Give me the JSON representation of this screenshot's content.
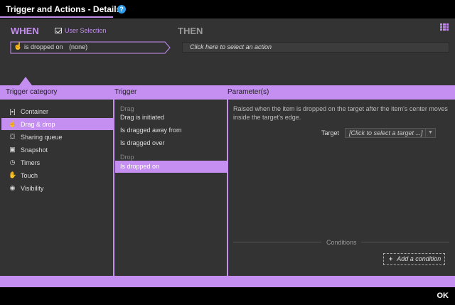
{
  "window": {
    "title": "Trigger and Actions - Details",
    "help_icon": "?"
  },
  "when": {
    "label": "WHEN",
    "user_selection": "User Selection",
    "trigger_text": "is dropped on",
    "trigger_value": "(none)"
  },
  "then": {
    "label": "THEN",
    "action_placeholder": "Click here to select an action"
  },
  "headers": {
    "category": "Trigger category",
    "trigger": "Trigger",
    "parameters": "Parameter(s)"
  },
  "categories": [
    {
      "label": "Container",
      "icon": "container-icon",
      "glyph": "[▪]"
    },
    {
      "label": "Drag & drop",
      "icon": "drag-drop-icon",
      "glyph": "☝"
    },
    {
      "label": "Sharing queue",
      "icon": "sharing-queue-icon",
      "glyph": "⛋"
    },
    {
      "label": "Snapshot",
      "icon": "snapshot-icon",
      "glyph": "▣"
    },
    {
      "label": "Timers",
      "icon": "timer-icon",
      "glyph": "◷"
    },
    {
      "label": "Touch",
      "icon": "touch-icon",
      "glyph": "✋"
    },
    {
      "label": "Visibility",
      "icon": "eye-icon",
      "glyph": "◉"
    }
  ],
  "selected_category": "Drag & drop",
  "trigger_groups": {
    "drag": "Drag",
    "drop": "Drop"
  },
  "triggers": {
    "drag": [
      "Drag is initiated",
      "Is dragged away from",
      "Is dragged over"
    ],
    "drop": [
      "Is dropped on"
    ]
  },
  "selected_trigger": "Is dropped on",
  "parameters": {
    "description": "Raised when the item is dropped on the target after the item's center moves inside the target's edge.",
    "target_label": "Target",
    "target_placeholder": "[Click to select a target ...]"
  },
  "conditions": {
    "label": "Conditions",
    "add_button": "Add a condition",
    "add_glyph": "+"
  },
  "footer": {
    "ok": "OK"
  },
  "colors": {
    "accent": "#c48ff0",
    "panel": "#333333",
    "background": "#000000",
    "help": "#2d9be8"
  }
}
